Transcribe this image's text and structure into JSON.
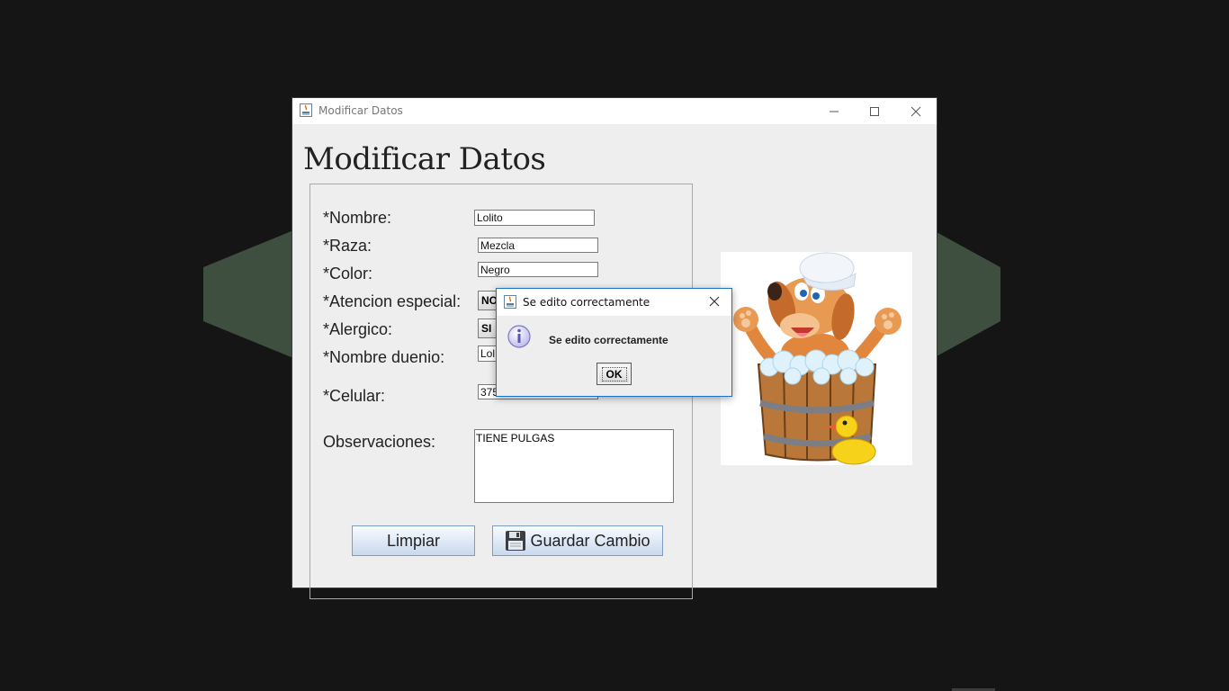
{
  "window": {
    "title": "Modificar Datos",
    "heading": "Modificar Datos",
    "controls": [
      "minimize-icon",
      "maximize-icon",
      "close-icon"
    ]
  },
  "form": {
    "nombre_label": "*Nombre:",
    "nombre_value": "Lolito",
    "raza_label": "*Raza:",
    "raza_value": "Mezcla",
    "color_label": "*Color:",
    "color_value": "Negro",
    "atencion_label": "*Atencion especial:",
    "atencion_value": "NO",
    "alergico_label": "*Alergico:",
    "alergico_value": "SI",
    "duenio_label": "*Nombre duenio:",
    "duenio_value": "Lol",
    "celular_label": "*Celular:",
    "celular_value": "375",
    "observaciones_label": "Observaciones:",
    "observaciones_value": "TIENE PULGAS"
  },
  "buttons": {
    "clear_label": "Limpiar",
    "save_label": "Guardar Cambio",
    "save_icon": "floppy-disk-icon"
  },
  "dialog": {
    "title": "Se edito correctamente",
    "message": "Se edito correctamente",
    "ok_label": "OK",
    "icon": "info-icon"
  },
  "colors": {
    "dialog_border": "#1b72c5",
    "button_gradient_bottom": "#c8d9ee",
    "background": "#151515"
  }
}
